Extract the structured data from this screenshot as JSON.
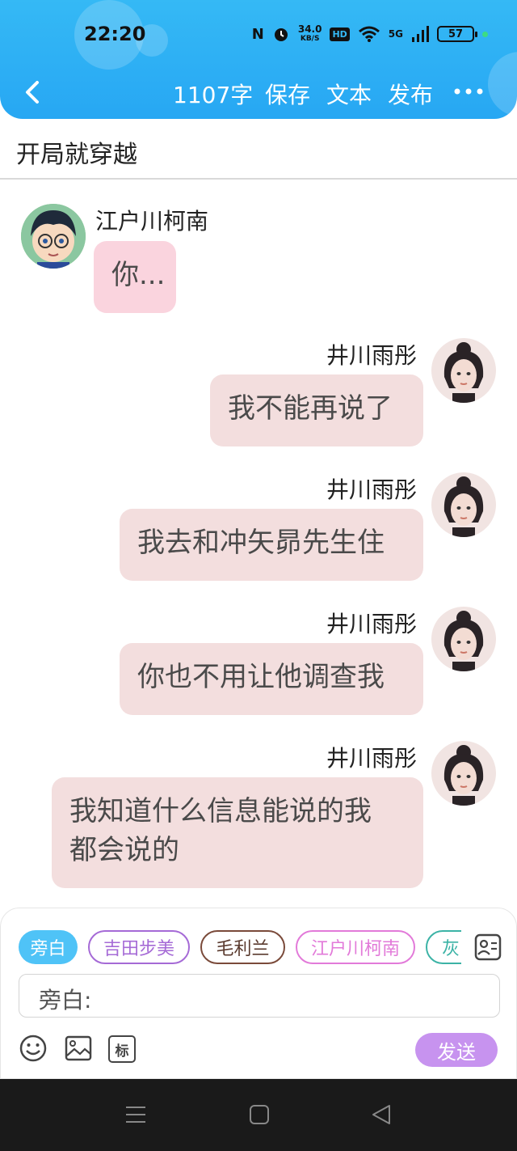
{
  "status_bar": {
    "time": "22:20",
    "net_speed_value": "34.0",
    "net_speed_unit": "KB/S",
    "hd": "HD",
    "signal": "5G",
    "battery": "57"
  },
  "toolbar": {
    "word_count": "1107字",
    "save": "保存",
    "text": "文本",
    "publish": "发布"
  },
  "story": {
    "title": "开局就穿越"
  },
  "messages": [
    {
      "side": "left",
      "name": "江户川柯南",
      "text": "你..."
    },
    {
      "side": "right",
      "name": "井川雨彤",
      "text": "我不能再说了"
    },
    {
      "side": "right",
      "name": "井川雨彤",
      "text": "我去和冲矢昴先生住"
    },
    {
      "side": "right",
      "name": "井川雨彤",
      "text": "你也不用让他调查我"
    },
    {
      "side": "right",
      "name": "井川雨彤",
      "text_line1": "我知道什么信息能说的我",
      "text_line2": "都会说的"
    }
  ],
  "composer": {
    "chips": [
      "旁白",
      "吉田步美",
      "毛利兰",
      "江户川柯南",
      "灰"
    ],
    "chip_colors": [
      "#4fc3f7",
      "#a56ad6",
      "#7a4a3a",
      "#e27ad9",
      "#3cb3a6"
    ],
    "input_label": "旁白:",
    "tools": [
      "emoji-icon",
      "image-icon",
      "tag-icon"
    ],
    "tag_label": "标",
    "send": "发送"
  }
}
